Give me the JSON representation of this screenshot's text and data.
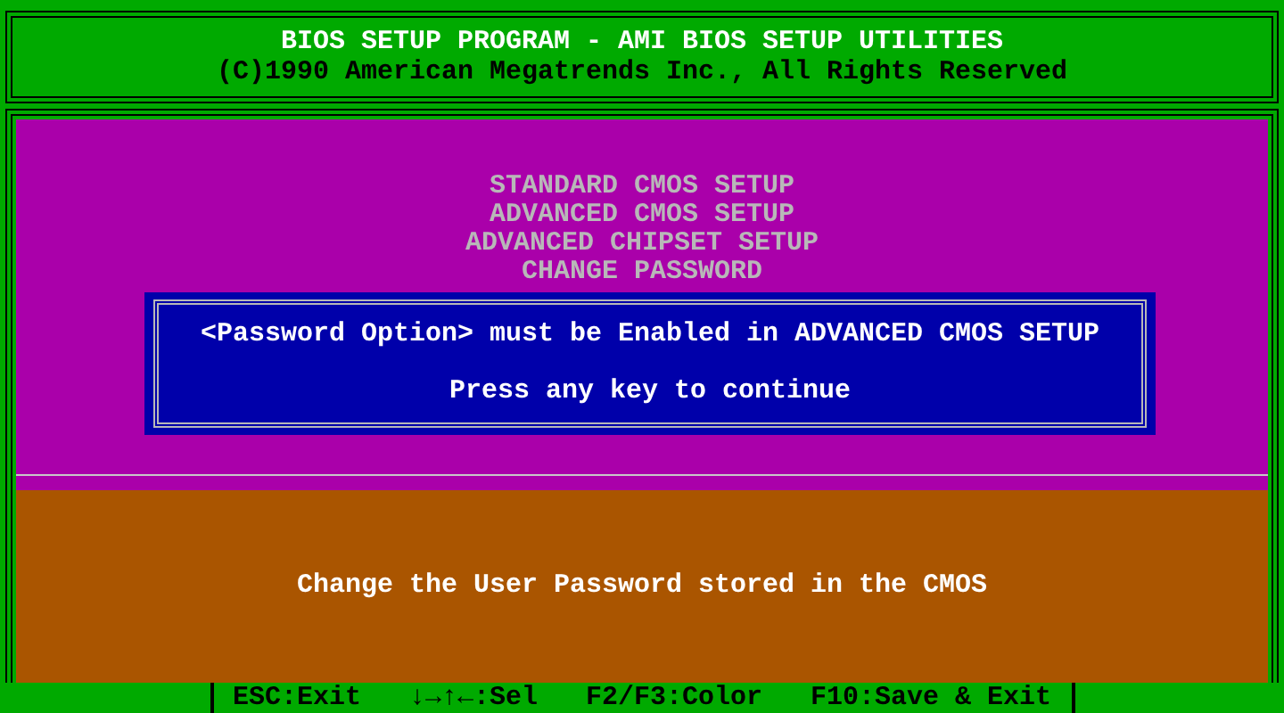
{
  "header": {
    "title": "BIOS SETUP PROGRAM - AMI BIOS SETUP UTILITIES",
    "copyright": "(C)1990 American Megatrends Inc., All Rights Reserved"
  },
  "menu": {
    "items": [
      {
        "label": "STANDARD CMOS SETUP"
      },
      {
        "label": "ADVANCED CMOS SETUP"
      },
      {
        "label": "ADVANCED CHIPSET SETUP"
      },
      {
        "label": "CHANGE PASSWORD"
      }
    ]
  },
  "dialog": {
    "message": "<Password Option> must be Enabled in ADVANCED CMOS SETUP",
    "prompt": "Press any key to continue"
  },
  "help": {
    "text": "Change the User Password stored in the CMOS"
  },
  "footer": {
    "keys": [
      "ESC:Exit",
      "↓→↑←:Sel",
      "F2/F3:Color",
      "F10:Save & Exit"
    ]
  }
}
